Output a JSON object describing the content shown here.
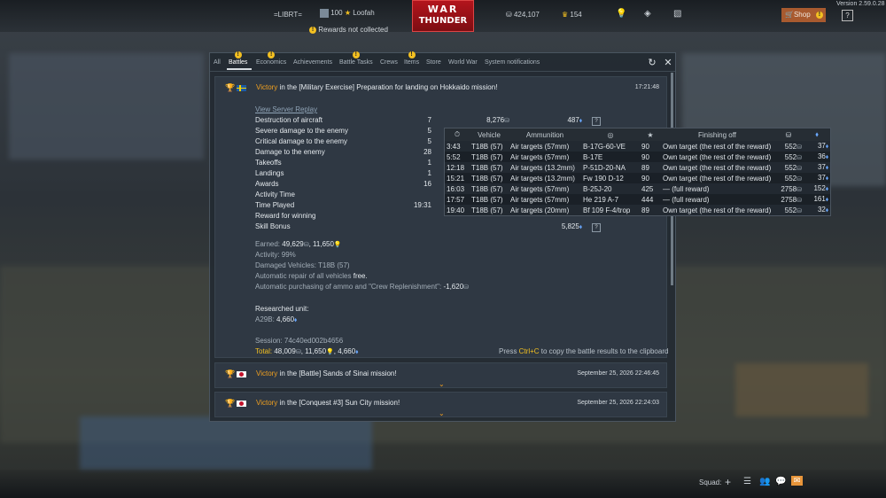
{
  "topbar": {
    "squad_tag": "=LIBRT=",
    "level": "100",
    "player": "Loofah",
    "silver": "424,107",
    "gold": "154",
    "shop_label": "Shop",
    "help_label": "?",
    "version": "Version 2.59.0.28",
    "rewards_notice": "Rewards not collected",
    "logo_line1": "WAR",
    "logo_line2": "THUNDER"
  },
  "tabs": [
    {
      "label": "All",
      "notify": false
    },
    {
      "label": "Battles",
      "notify": true,
      "active": true
    },
    {
      "label": "Economics",
      "notify": true
    },
    {
      "label": "Achievements",
      "notify": false
    },
    {
      "label": "Battle Tasks",
      "notify": true
    },
    {
      "label": "Crews",
      "notify": false
    },
    {
      "label": "Items",
      "notify": true
    },
    {
      "label": "Store",
      "notify": false
    },
    {
      "label": "World War",
      "notify": false
    },
    {
      "label": "System notifications",
      "notify": false
    }
  ],
  "entries": [
    {
      "victory": "Victory",
      "title_rest": " in the [Military Exercise] Preparation for landing on Hokkaido mission!",
      "time": "17:21:48",
      "flag": "sweden",
      "replay_link": "View Server Replay",
      "stats": [
        {
          "label": "Destruction of aircraft",
          "count": "7",
          "silver": "8,276",
          "rp": "487"
        },
        {
          "label": "Severe damage to the enemy",
          "count": "5",
          "silver": "",
          "rp": ""
        },
        {
          "label": "Critical damage to the enemy",
          "count": "5",
          "silver": "",
          "rp": ""
        },
        {
          "label": "Damage to the enemy",
          "count": "28",
          "silver": "",
          "rp": ""
        },
        {
          "label": "Takeoffs",
          "count": "1",
          "silver": "",
          "rp": ""
        },
        {
          "label": "Landings",
          "count": "1",
          "silver": "",
          "rp": ""
        },
        {
          "label": "Awards",
          "count": "16",
          "silver": "",
          "rp": ""
        },
        {
          "label": "Activity Time",
          "count": "",
          "silver": "",
          "rp": ""
        },
        {
          "label": "Time Played",
          "count": "19:31",
          "silver": "",
          "rp": ""
        },
        {
          "label": "Reward for winning",
          "count": "",
          "silver": "",
          "rp": ""
        },
        {
          "label": "Skill Bonus",
          "count": "",
          "silver": "",
          "rp": "5,825"
        }
      ],
      "earned_label": "Earned: ",
      "earned_silver": "49,629",
      "earned_rp": "11,650",
      "activity": "Activity: 99%",
      "damaged": "Damaged Vehicles: T18B (57)",
      "auto_repair_label": "Automatic repair of all vehicles ",
      "auto_repair_value": "free.",
      "auto_purchase_label": "Automatic purchasing of ammo and \"Crew Replenishment\": ",
      "auto_purchase_value": "-1,620",
      "researched_label": "Researched unit:",
      "researched_unit": "A29B: ",
      "researched_rp": "4,660",
      "session": "Session: 74c40ed002b4656",
      "total_label": "Total: ",
      "total_silver": "48,009",
      "total_rp": "11,650",
      "total_rp2": "4,660",
      "copy_hint_pre": "Press ",
      "copy_hint_key": "Ctrl+C",
      "copy_hint_post": " to copy the battle results to the clipboard"
    },
    {
      "victory": "Victory",
      "title_rest": " in the [Battle] Sands of Sinai mission!",
      "time": "September 25, 2026 22:46:45",
      "flag": "japan"
    },
    {
      "victory": "Victory",
      "title_rest": " in the [Conquest #3] Sun City mission!",
      "time": "September 25, 2026 22:24:03",
      "flag": "japan"
    }
  ],
  "kills_table": {
    "headers": [
      "",
      "Vehicle",
      "Ammunition",
      "",
      "",
      "Finishing off",
      "",
      ""
    ],
    "rows": [
      [
        "3:43",
        "T18B (57)",
        "Air targets (57mm)",
        "B-17G-60-VE",
        "90",
        "Own target (the rest of the reward)",
        "552",
        "37"
      ],
      [
        "5:52",
        "T18B (57)",
        "Air targets (57mm)",
        "B-17E",
        "90",
        "Own target (the rest of the reward)",
        "552",
        "36"
      ],
      [
        "12:18",
        "T18B (57)",
        "Air targets (13.2mm)",
        "P-51D-20-NA",
        "89",
        "Own target (the rest of the reward)",
        "552",
        "37"
      ],
      [
        "15:21",
        "T18B (57)",
        "Air targets (13.2mm)",
        "Fw 190 D-12",
        "90",
        "Own target (the rest of the reward)",
        "552",
        "37"
      ],
      [
        "16:03",
        "T18B (57)",
        "Air targets (57mm)",
        "B-25J-20",
        "425",
        "— (full reward)",
        "2758",
        "152"
      ],
      [
        "17:57",
        "T18B (57)",
        "Air targets (57mm)",
        "He 219 A-7",
        "444",
        "— (full reward)",
        "2758",
        "161"
      ],
      [
        "19:40",
        "T18B (57)",
        "Air targets (20mm)",
        "Bf 109 F-4/trop",
        "89",
        "Own target (the rest of the reward)",
        "552",
        "32"
      ]
    ]
  },
  "bottombar": {
    "squad_label": "Squad:"
  },
  "colors": {
    "victory": "#f1a020",
    "accent_red": "#b3141c",
    "rp_blue": "#6aa8ff",
    "silver_lion": "#f3c021"
  }
}
